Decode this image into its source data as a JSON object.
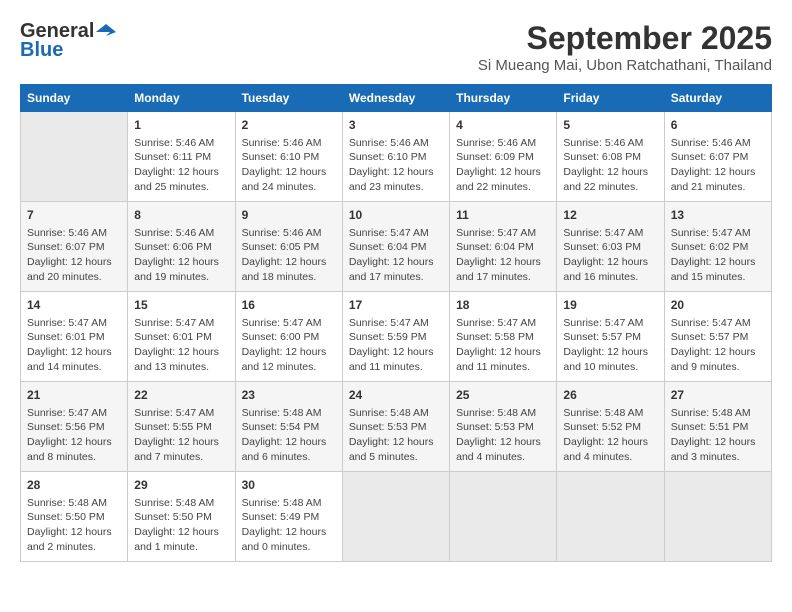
{
  "logo": {
    "general": "General",
    "blue": "Blue"
  },
  "title": "September 2025",
  "subtitle": "Si Mueang Mai, Ubon Ratchathani, Thailand",
  "days_of_week": [
    "Sunday",
    "Monday",
    "Tuesday",
    "Wednesday",
    "Thursday",
    "Friday",
    "Saturday"
  ],
  "weeks": [
    [
      {
        "day": "",
        "info": ""
      },
      {
        "day": "1",
        "info": "Sunrise: 5:46 AM\nSunset: 6:11 PM\nDaylight: 12 hours\nand 25 minutes."
      },
      {
        "day": "2",
        "info": "Sunrise: 5:46 AM\nSunset: 6:10 PM\nDaylight: 12 hours\nand 24 minutes."
      },
      {
        "day": "3",
        "info": "Sunrise: 5:46 AM\nSunset: 6:10 PM\nDaylight: 12 hours\nand 23 minutes."
      },
      {
        "day": "4",
        "info": "Sunrise: 5:46 AM\nSunset: 6:09 PM\nDaylight: 12 hours\nand 22 minutes."
      },
      {
        "day": "5",
        "info": "Sunrise: 5:46 AM\nSunset: 6:08 PM\nDaylight: 12 hours\nand 22 minutes."
      },
      {
        "day": "6",
        "info": "Sunrise: 5:46 AM\nSunset: 6:07 PM\nDaylight: 12 hours\nand 21 minutes."
      }
    ],
    [
      {
        "day": "7",
        "info": "Sunrise: 5:46 AM\nSunset: 6:07 PM\nDaylight: 12 hours\nand 20 minutes."
      },
      {
        "day": "8",
        "info": "Sunrise: 5:46 AM\nSunset: 6:06 PM\nDaylight: 12 hours\nand 19 minutes."
      },
      {
        "day": "9",
        "info": "Sunrise: 5:46 AM\nSunset: 6:05 PM\nDaylight: 12 hours\nand 18 minutes."
      },
      {
        "day": "10",
        "info": "Sunrise: 5:47 AM\nSunset: 6:04 PM\nDaylight: 12 hours\nand 17 minutes."
      },
      {
        "day": "11",
        "info": "Sunrise: 5:47 AM\nSunset: 6:04 PM\nDaylight: 12 hours\nand 17 minutes."
      },
      {
        "day": "12",
        "info": "Sunrise: 5:47 AM\nSunset: 6:03 PM\nDaylight: 12 hours\nand 16 minutes."
      },
      {
        "day": "13",
        "info": "Sunrise: 5:47 AM\nSunset: 6:02 PM\nDaylight: 12 hours\nand 15 minutes."
      }
    ],
    [
      {
        "day": "14",
        "info": "Sunrise: 5:47 AM\nSunset: 6:01 PM\nDaylight: 12 hours\nand 14 minutes."
      },
      {
        "day": "15",
        "info": "Sunrise: 5:47 AM\nSunset: 6:01 PM\nDaylight: 12 hours\nand 13 minutes."
      },
      {
        "day": "16",
        "info": "Sunrise: 5:47 AM\nSunset: 6:00 PM\nDaylight: 12 hours\nand 12 minutes."
      },
      {
        "day": "17",
        "info": "Sunrise: 5:47 AM\nSunset: 5:59 PM\nDaylight: 12 hours\nand 11 minutes."
      },
      {
        "day": "18",
        "info": "Sunrise: 5:47 AM\nSunset: 5:58 PM\nDaylight: 12 hours\nand 11 minutes."
      },
      {
        "day": "19",
        "info": "Sunrise: 5:47 AM\nSunset: 5:57 PM\nDaylight: 12 hours\nand 10 minutes."
      },
      {
        "day": "20",
        "info": "Sunrise: 5:47 AM\nSunset: 5:57 PM\nDaylight: 12 hours\nand 9 minutes."
      }
    ],
    [
      {
        "day": "21",
        "info": "Sunrise: 5:47 AM\nSunset: 5:56 PM\nDaylight: 12 hours\nand 8 minutes."
      },
      {
        "day": "22",
        "info": "Sunrise: 5:47 AM\nSunset: 5:55 PM\nDaylight: 12 hours\nand 7 minutes."
      },
      {
        "day": "23",
        "info": "Sunrise: 5:48 AM\nSunset: 5:54 PM\nDaylight: 12 hours\nand 6 minutes."
      },
      {
        "day": "24",
        "info": "Sunrise: 5:48 AM\nSunset: 5:53 PM\nDaylight: 12 hours\nand 5 minutes."
      },
      {
        "day": "25",
        "info": "Sunrise: 5:48 AM\nSunset: 5:53 PM\nDaylight: 12 hours\nand 4 minutes."
      },
      {
        "day": "26",
        "info": "Sunrise: 5:48 AM\nSunset: 5:52 PM\nDaylight: 12 hours\nand 4 minutes."
      },
      {
        "day": "27",
        "info": "Sunrise: 5:48 AM\nSunset: 5:51 PM\nDaylight: 12 hours\nand 3 minutes."
      }
    ],
    [
      {
        "day": "28",
        "info": "Sunrise: 5:48 AM\nSunset: 5:50 PM\nDaylight: 12 hours\nand 2 minutes."
      },
      {
        "day": "29",
        "info": "Sunrise: 5:48 AM\nSunset: 5:50 PM\nDaylight: 12 hours\nand 1 minute."
      },
      {
        "day": "30",
        "info": "Sunrise: 5:48 AM\nSunset: 5:49 PM\nDaylight: 12 hours\nand 0 minutes."
      },
      {
        "day": "",
        "info": ""
      },
      {
        "day": "",
        "info": ""
      },
      {
        "day": "",
        "info": ""
      },
      {
        "day": "",
        "info": ""
      }
    ]
  ]
}
